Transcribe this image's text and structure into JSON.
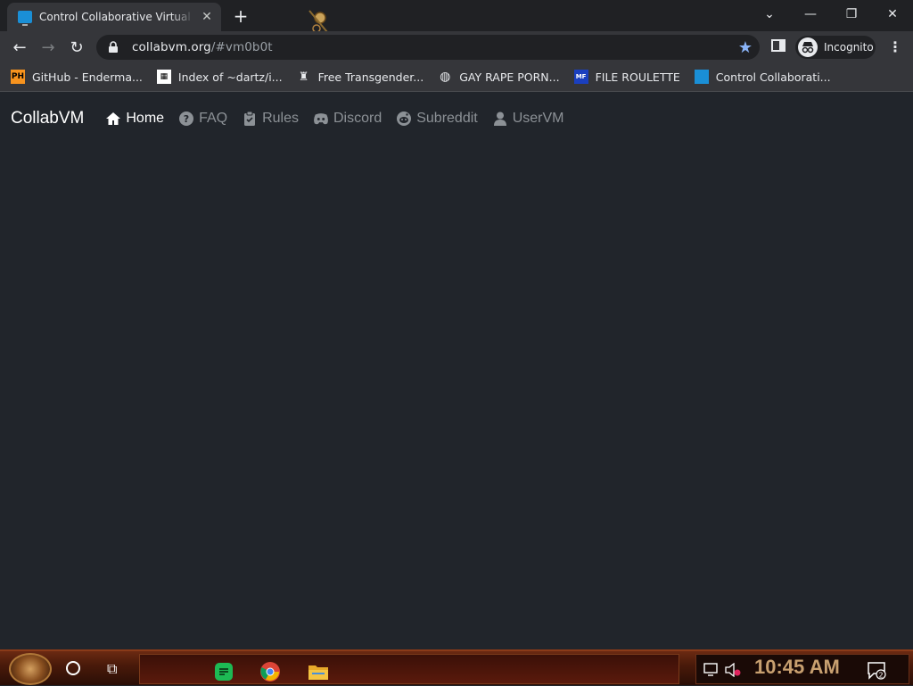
{
  "browser": {
    "tab": {
      "title": "Control Collaborative Virtual Machines",
      "favicon": "monitor-icon"
    },
    "url": {
      "host": "collabvm.org",
      "path": "/#vm0b0t"
    },
    "profile_label": "Incognito",
    "bookmarks": [
      {
        "label": "GitHub - Enderma...",
        "icon": "ph-icon"
      },
      {
        "label": "Index of ~dartz/i...",
        "icon": "qr-icon"
      },
      {
        "label": "Free Transgender...",
        "icon": "robot-icon"
      },
      {
        "label": "GAY RAPE PORN...",
        "icon": "globe-icon"
      },
      {
        "label": "FILE ROULETTE",
        "icon": "mft-icon"
      },
      {
        "label": "Control Collaborati...",
        "icon": "monitor-icon"
      }
    ]
  },
  "site": {
    "brand": "CollabVM",
    "nav": [
      {
        "label": "Home",
        "icon": "home-icon",
        "active": true
      },
      {
        "label": "FAQ",
        "icon": "question-icon",
        "active": false
      },
      {
        "label": "Rules",
        "icon": "clipboard-icon",
        "active": false
      },
      {
        "label": "Discord",
        "icon": "discord-icon",
        "active": false
      },
      {
        "label": "Subreddit",
        "icon": "reddit-icon",
        "active": false
      },
      {
        "label": "UserVM",
        "icon": "user-icon",
        "active": false
      }
    ]
  },
  "taskbar": {
    "clock": "10:45 AM",
    "notification_count": "2"
  },
  "colors": {
    "page_bg": "#21252b",
    "chrome_dark": "#202124",
    "chrome_toolbar": "#35363a",
    "accent_star": "#8ab4f8"
  }
}
